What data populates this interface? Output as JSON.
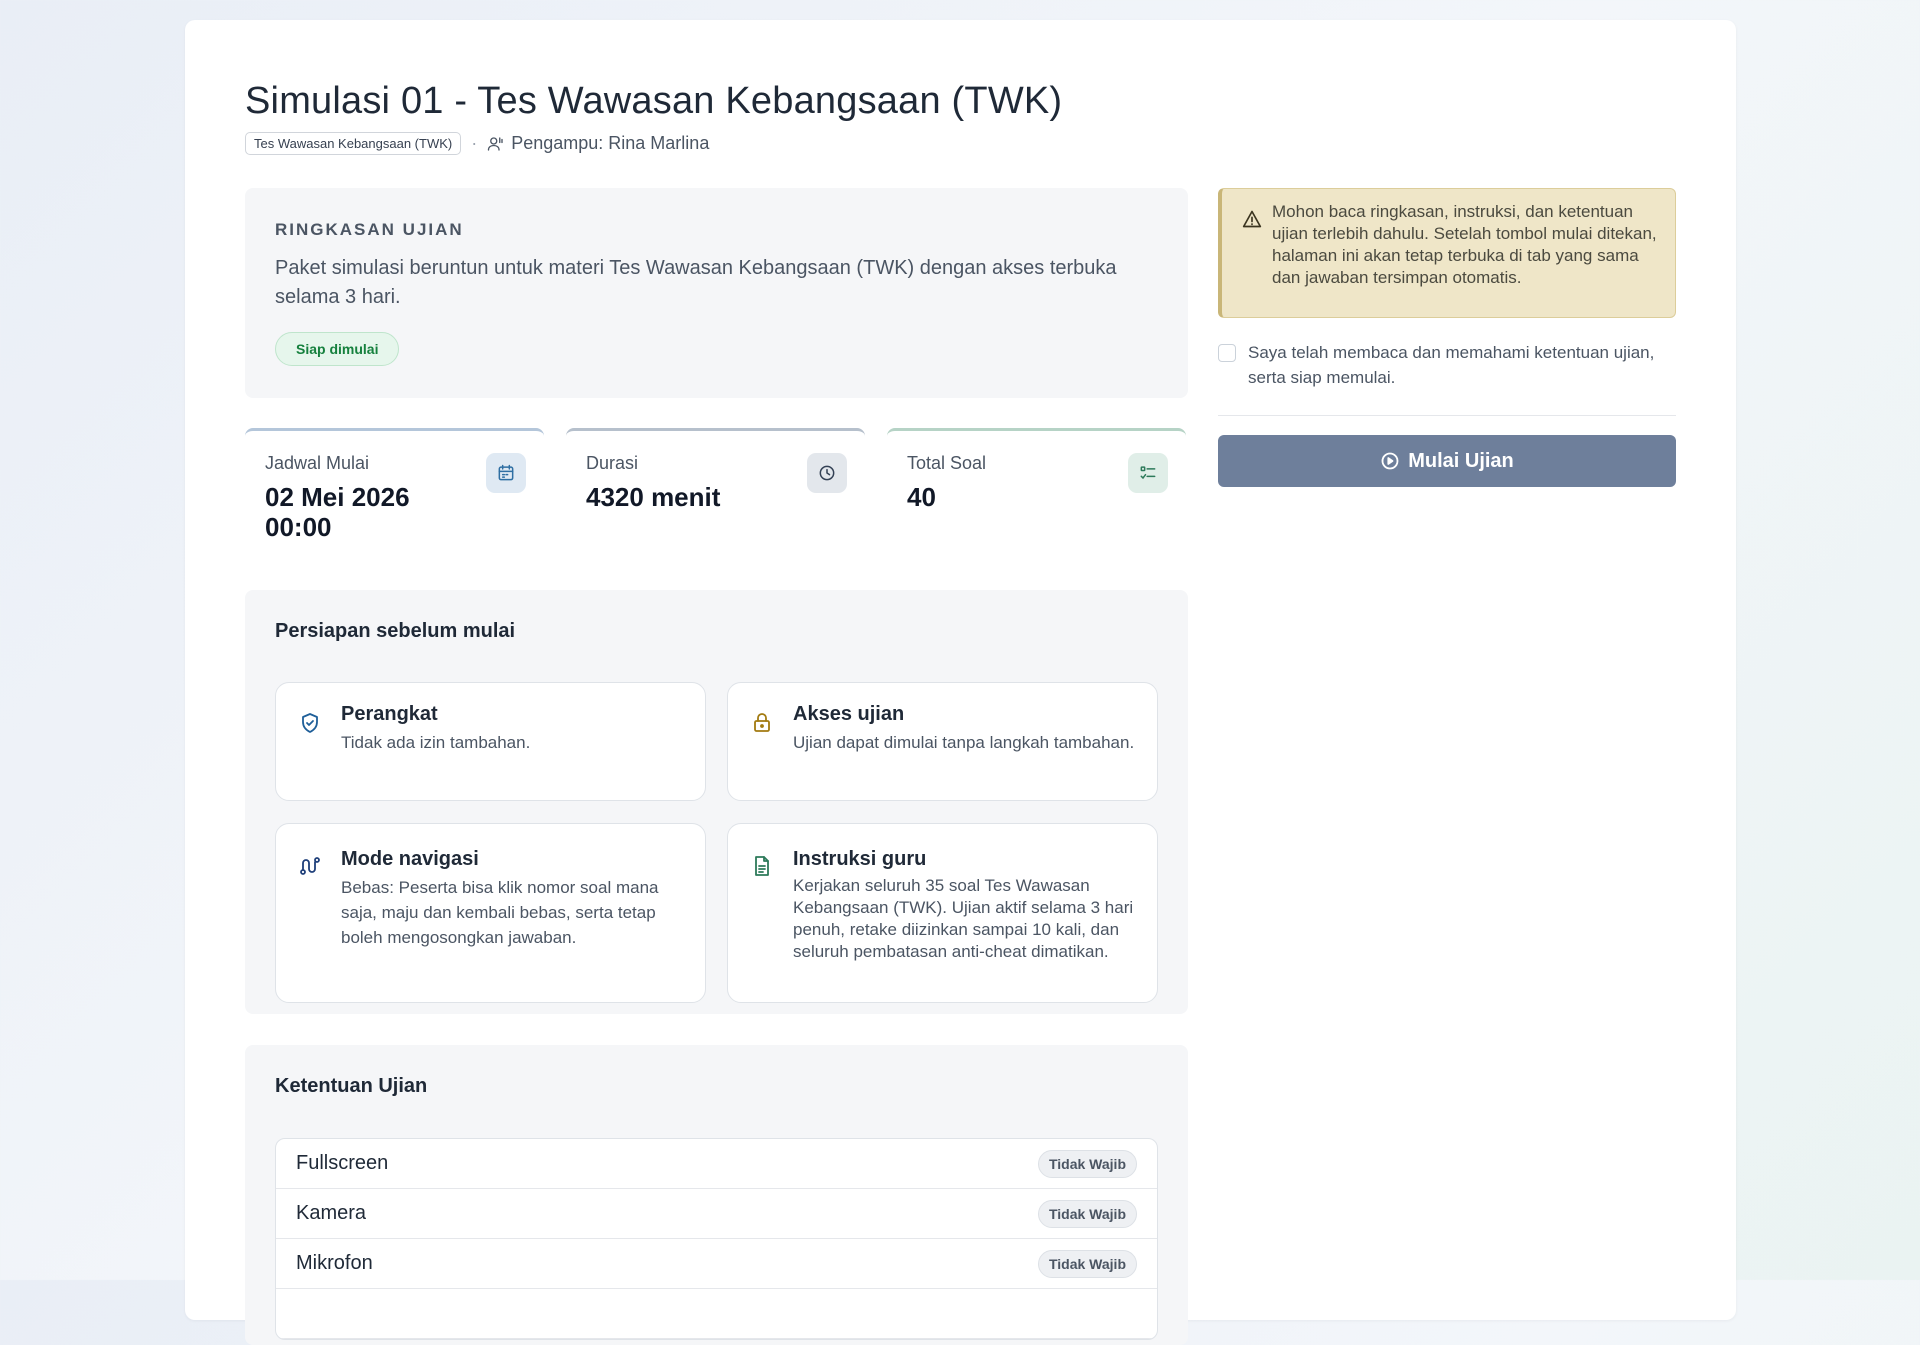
{
  "exam": {
    "title": "Simulasi 01 - Tes Wawasan Kebangsaan (TWK)",
    "category_chip": "Tes Wawasan Kebangsaan (TWK)",
    "separator": "·",
    "teacher": "Pengampu: Rina Marlina"
  },
  "summary": {
    "kicker": "RINGKASAN UJIAN",
    "description": "Paket simulasi beruntun untuk materi Tes Wawasan Kebangsaan (TWK) dengan akses terbuka selama 3 hari.",
    "status": "Siap dimulai"
  },
  "stats": [
    {
      "label": "Jadwal Mulai",
      "value": "02 Mei 2026 00:00",
      "icon": "calendar-icon"
    },
    {
      "label": "Durasi",
      "value": "4320 menit",
      "icon": "clock-icon"
    },
    {
      "label": "Total Soal",
      "value": "40",
      "icon": "checklist-icon"
    }
  ],
  "prep": {
    "title": "Persiapan sebelum mulai",
    "items": [
      {
        "title": "Perangkat",
        "text": "Tidak ada izin tambahan.",
        "icon": "shield-check-icon"
      },
      {
        "title": "Akses ujian",
        "text": "Ujian dapat dimulai tanpa langkah tambahan.",
        "icon": "lock-icon"
      },
      {
        "title": "Mode navigasi",
        "text": "Bebas: Peserta bisa klik nomor soal mana saja, maju dan kembali bebas, serta tetap boleh mengosongkan jawaban.",
        "icon": "route-icon"
      },
      {
        "title": "Instruksi guru",
        "text": "Kerjakan seluruh 35 soal Tes Wawasan Kebangsaan (TWK). Ujian aktif selama 3 hari penuh, retake diizinkan sampai 10 kali, dan seluruh pembatasan anti-cheat dimatikan.",
        "icon": "document-icon"
      }
    ]
  },
  "rules": {
    "title": "Ketentuan Ujian",
    "rows": [
      {
        "name": "Fullscreen",
        "badge": "Tidak Wajib"
      },
      {
        "name": "Kamera",
        "badge": "Tidak Wajib"
      },
      {
        "name": "Mikrofon",
        "badge": "Tidak Wajib"
      }
    ]
  },
  "notice": {
    "text": "Mohon baca ringkasan, instruksi, dan ketentuan ujian terlebih dahulu. Setelah tombol mulai ditekan, halaman ini akan tetap terbuka di tab yang sama dan jawaban tersimpan otomatis."
  },
  "agree": {
    "label": "Saya telah membaca dan memahami ketentuan ujian, serta siap memulai.",
    "checked": false
  },
  "actions": {
    "start_label": "Mulai Ujian"
  },
  "colors": {
    "start_button": "#6e7f9b",
    "status_green": "#15803d",
    "notice_bg": "#efe6c8"
  }
}
